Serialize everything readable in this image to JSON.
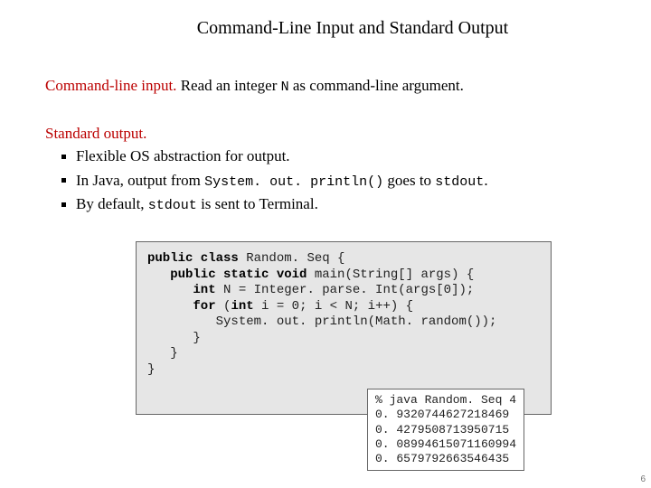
{
  "title": "Command-Line Input and Standard Output",
  "cli": {
    "heading": "Command-line input.",
    "body_pre": "  Read an integer ",
    "body_code": "N",
    "body_post": " as command-line argument."
  },
  "stdout": {
    "heading": "Standard output.",
    "bullets": [
      {
        "text": "Flexible OS abstraction for output."
      },
      {
        "pre": "In Java, output from ",
        "code1": "System. out. println()",
        "mid": " goes to ",
        "code2": "stdout",
        "post": "."
      },
      {
        "pre": "By default, ",
        "code1": "stdout",
        "post": " is sent to Terminal."
      }
    ]
  },
  "code": {
    "l1a": "public class",
    "l1b": " Random. Seq {",
    "l2a": "   public static void",
    "l2b": " main(String[] args) {",
    "l3a": "      int",
    "l3b": " N = Integer. parse. Int(args[0]);",
    "l4a": "      for",
    "l4b": " (",
    "l4c": "int",
    "l4d": " i = 0; i < N; i++) {",
    "l5": "         System. out. println(Math. random());",
    "l6": "      }",
    "l7": "   }",
    "l8": "}"
  },
  "output": {
    "l1": "% java Random. Seq 4",
    "l2": "0. 9320744627218469",
    "l3": "0. 4279508713950715",
    "l4": "0. 08994615071160994",
    "l5": "0. 6579792663546435"
  },
  "page": "6"
}
